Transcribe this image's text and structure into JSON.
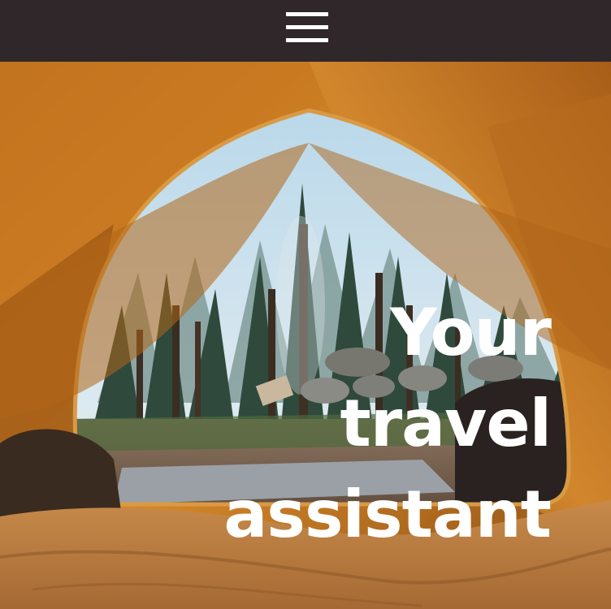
{
  "header": {
    "menu_icon": "hamburger-menu-icon",
    "background_color": "#2f2729"
  },
  "hero": {
    "image": "tent-forest-view-photo",
    "headline_lines": [
      "Your",
      "travel",
      "assistant"
    ],
    "headline_color": "#ffffff"
  }
}
